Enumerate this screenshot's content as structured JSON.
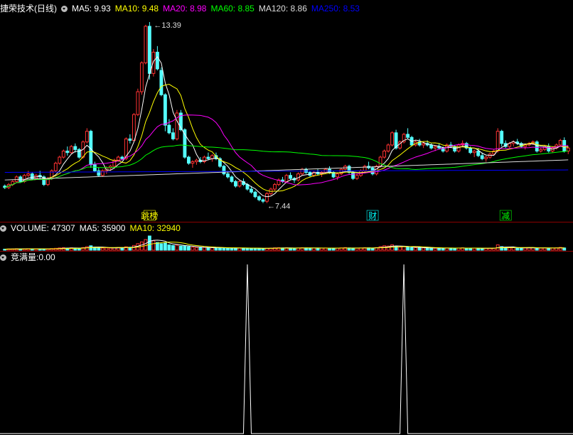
{
  "chart_data": [
    {
      "type": "candlestick",
      "title": "捷荣技术(日线)",
      "indicators": [
        {
          "label": "MA5",
          "value": "9.93",
          "color": "#ffffff"
        },
        {
          "label": "MA10",
          "value": "9.48",
          "color": "#ffff00"
        },
        {
          "label": "MA20",
          "value": "8.98",
          "color": "#ff00ff"
        },
        {
          "label": "MA60",
          "value": "8.85",
          "color": "#00ff00"
        },
        {
          "label": "MA120",
          "value": "8.86",
          "color": "#dddddd"
        },
        {
          "label": "MA250",
          "value": "8.53",
          "color": "#0000ff"
        }
      ],
      "ylim": [
        7.2,
        13.6
      ],
      "high_label": "13.39",
      "low_label": "7.44",
      "markers": [
        {
          "text": "跳榜",
          "index": 37,
          "color": "#ffff00"
        },
        {
          "text": "财",
          "index": 94,
          "color": "#00ffff"
        },
        {
          "text": "减",
          "index": 128,
          "color": "#00ff00"
        }
      ],
      "ohlc": [
        [
          8.0,
          8.05,
          7.9,
          7.95
        ],
        [
          7.95,
          8.1,
          7.9,
          8.05
        ],
        [
          8.05,
          8.2,
          8.0,
          8.15
        ],
        [
          8.15,
          8.35,
          8.1,
          8.3
        ],
        [
          8.3,
          8.35,
          8.1,
          8.15
        ],
        [
          8.15,
          8.4,
          8.1,
          8.35
        ],
        [
          8.35,
          8.5,
          8.3,
          8.4
        ],
        [
          8.4,
          8.45,
          8.2,
          8.25
        ],
        [
          8.25,
          8.4,
          8.2,
          8.35
        ],
        [
          8.35,
          8.5,
          8.2,
          8.3
        ],
        [
          8.3,
          8.35,
          8.0,
          8.05
        ],
        [
          8.05,
          8.3,
          8.0,
          8.25
        ],
        [
          8.25,
          8.55,
          8.2,
          8.5
        ],
        [
          8.5,
          8.8,
          8.45,
          8.75
        ],
        [
          8.75,
          9.0,
          8.7,
          8.95
        ],
        [
          8.95,
          9.2,
          8.9,
          9.15
        ],
        [
          9.15,
          9.3,
          9.0,
          9.1
        ],
        [
          9.1,
          9.35,
          9.05,
          9.3
        ],
        [
          9.3,
          9.4,
          9.1,
          9.2
        ],
        [
          9.2,
          9.25,
          8.9,
          8.95
        ],
        [
          8.95,
          9.5,
          8.9,
          9.45
        ],
        [
          9.45,
          9.9,
          9.4,
          9.8
        ],
        [
          9.8,
          9.85,
          8.6,
          8.7
        ],
        [
          8.7,
          8.8,
          8.45,
          8.5
        ],
        [
          8.5,
          8.6,
          8.3,
          8.35
        ],
        [
          8.35,
          8.55,
          8.3,
          8.5
        ],
        [
          8.5,
          8.65,
          8.4,
          8.6
        ],
        [
          8.6,
          8.7,
          8.5,
          8.65
        ],
        [
          8.65,
          8.9,
          8.6,
          8.85
        ],
        [
          8.85,
          9.0,
          8.8,
          8.95
        ],
        [
          8.95,
          9.0,
          8.85,
          8.9
        ],
        [
          8.9,
          9.6,
          8.85,
          9.55
        ],
        [
          9.55,
          9.7,
          9.4,
          9.5
        ],
        [
          9.5,
          10.4,
          9.45,
          10.35
        ],
        [
          10.35,
          11.2,
          10.3,
          11.1
        ],
        [
          11.1,
          12.1,
          11.0,
          12.05
        ],
        [
          12.05,
          13.3,
          12.0,
          13.25
        ],
        [
          13.25,
          13.39,
          11.5,
          11.7
        ],
        [
          11.7,
          12.5,
          11.6,
          12.4
        ],
        [
          12.4,
          12.6,
          11.8,
          11.85
        ],
        [
          11.8,
          11.9,
          10.95,
          11.0
        ],
        [
          11.0,
          11.05,
          9.8,
          10.0
        ],
        [
          10.0,
          10.2,
          9.7,
          9.75
        ],
        [
          9.75,
          9.9,
          9.5,
          9.55
        ],
        [
          9.55,
          10.5,
          9.5,
          10.4
        ],
        [
          10.4,
          10.5,
          9.8,
          9.85
        ],
        [
          9.85,
          9.9,
          8.9,
          8.95
        ],
        [
          8.95,
          9.0,
          8.7,
          8.75
        ],
        [
          8.75,
          8.85,
          8.6,
          8.8
        ],
        [
          8.8,
          8.9,
          8.7,
          8.85
        ],
        [
          8.85,
          8.95,
          8.75,
          8.8
        ],
        [
          8.8,
          9.0,
          8.75,
          8.95
        ],
        [
          8.95,
          9.1,
          8.85,
          8.9
        ],
        [
          8.9,
          9.05,
          8.8,
          9.0
        ],
        [
          9.0,
          9.1,
          8.85,
          8.9
        ],
        [
          8.9,
          8.95,
          8.6,
          8.65
        ],
        [
          8.65,
          8.7,
          8.35,
          8.4
        ],
        [
          8.4,
          8.5,
          8.25,
          8.3
        ],
        [
          8.3,
          8.35,
          8.1,
          8.15
        ],
        [
          8.15,
          8.2,
          7.95,
          8.0
        ],
        [
          8.0,
          8.2,
          7.95,
          8.15
        ],
        [
          8.15,
          8.25,
          8.0,
          8.05
        ],
        [
          8.05,
          8.1,
          7.85,
          7.9
        ],
        [
          7.9,
          8.0,
          7.75,
          7.8
        ],
        [
          7.8,
          7.85,
          7.6,
          7.65
        ],
        [
          7.65,
          7.7,
          7.5,
          7.55
        ],
        [
          7.55,
          7.6,
          7.44,
          7.5
        ],
        [
          7.5,
          7.8,
          7.44,
          7.75
        ],
        [
          7.75,
          7.95,
          7.7,
          7.9
        ],
        [
          7.9,
          8.1,
          7.85,
          8.05
        ],
        [
          8.05,
          8.25,
          8.0,
          8.2
        ],
        [
          8.2,
          8.3,
          8.1,
          8.15
        ],
        [
          8.15,
          8.4,
          8.1,
          8.35
        ],
        [
          8.35,
          8.45,
          8.2,
          8.25
        ],
        [
          8.25,
          8.3,
          8.1,
          8.2
        ],
        [
          8.2,
          8.45,
          8.15,
          8.4
        ],
        [
          8.4,
          8.6,
          8.35,
          8.55
        ],
        [
          8.55,
          8.6,
          8.4,
          8.45
        ],
        [
          8.45,
          8.5,
          8.3,
          8.35
        ],
        [
          8.35,
          8.5,
          8.3,
          8.45
        ],
        [
          8.45,
          8.55,
          8.35,
          8.4
        ],
        [
          8.4,
          8.5,
          8.3,
          8.45
        ],
        [
          8.45,
          8.6,
          8.4,
          8.55
        ],
        [
          8.55,
          8.65,
          8.4,
          8.45
        ],
        [
          8.45,
          8.5,
          8.25,
          8.3
        ],
        [
          8.3,
          8.45,
          8.2,
          8.4
        ],
        [
          8.4,
          8.6,
          8.35,
          8.55
        ],
        [
          8.55,
          8.7,
          8.5,
          8.65
        ],
        [
          8.65,
          8.7,
          8.4,
          8.45
        ],
        [
          8.45,
          8.5,
          8.2,
          8.25
        ],
        [
          8.25,
          8.4,
          8.2,
          8.35
        ],
        [
          8.35,
          8.55,
          8.3,
          8.5
        ],
        [
          8.5,
          8.7,
          8.45,
          8.65
        ],
        [
          8.65,
          8.8,
          8.55,
          8.6
        ],
        [
          8.6,
          8.65,
          8.35,
          8.4
        ],
        [
          8.4,
          8.7,
          8.35,
          8.65
        ],
        [
          8.65,
          9.0,
          8.6,
          8.95
        ],
        [
          8.95,
          9.2,
          8.9,
          9.15
        ],
        [
          9.15,
          9.4,
          9.1,
          9.35
        ],
        [
          9.35,
          9.8,
          9.3,
          9.75
        ],
        [
          9.75,
          9.85,
          9.2,
          9.25
        ],
        [
          9.25,
          9.5,
          9.2,
          9.45
        ],
        [
          9.45,
          9.75,
          9.4,
          9.7
        ],
        [
          9.7,
          9.9,
          9.55,
          9.6
        ],
        [
          9.6,
          9.65,
          9.3,
          9.35
        ],
        [
          9.35,
          9.5,
          9.3,
          9.45
        ],
        [
          9.45,
          9.55,
          9.3,
          9.35
        ],
        [
          9.35,
          9.45,
          9.25,
          9.4
        ],
        [
          9.4,
          9.5,
          9.3,
          9.35
        ],
        [
          9.35,
          9.4,
          9.2,
          9.25
        ],
        [
          9.25,
          9.35,
          9.15,
          9.3
        ],
        [
          9.3,
          9.4,
          9.2,
          9.25
        ],
        [
          9.25,
          9.3,
          9.1,
          9.15
        ],
        [
          9.15,
          9.4,
          9.1,
          9.35
        ],
        [
          9.35,
          9.45,
          9.25,
          9.3
        ],
        [
          9.3,
          9.35,
          9.1,
          9.15
        ],
        [
          9.15,
          9.4,
          9.1,
          9.35
        ],
        [
          9.35,
          9.5,
          9.3,
          9.4
        ],
        [
          9.4,
          9.45,
          9.2,
          9.25
        ],
        [
          9.25,
          9.3,
          9.05,
          9.1
        ],
        [
          9.1,
          9.2,
          8.95,
          9.15
        ],
        [
          9.15,
          9.25,
          8.95,
          9.0
        ],
        [
          9.0,
          9.1,
          8.85,
          8.9
        ],
        [
          8.9,
          9.0,
          8.8,
          8.95
        ],
        [
          8.95,
          9.1,
          8.9,
          9.05
        ],
        [
          9.05,
          9.2,
          9.0,
          9.15
        ],
        [
          9.15,
          9.9,
          9.1,
          9.8
        ],
        [
          9.8,
          9.85,
          9.3,
          9.4
        ],
        [
          9.4,
          9.5,
          9.25,
          9.3
        ],
        [
          9.3,
          9.45,
          9.25,
          9.4
        ],
        [
          9.4,
          9.5,
          9.3,
          9.45
        ],
        [
          9.45,
          9.55,
          9.35,
          9.4
        ],
        [
          9.4,
          9.45,
          9.25,
          9.3
        ],
        [
          9.3,
          9.4,
          9.2,
          9.35
        ],
        [
          9.35,
          9.45,
          9.3,
          9.4
        ],
        [
          9.4,
          9.5,
          9.35,
          9.45
        ],
        [
          9.45,
          9.5,
          9.1,
          9.15
        ],
        [
          9.15,
          9.25,
          9.1,
          9.2
        ],
        [
          9.2,
          9.35,
          9.15,
          9.3
        ],
        [
          9.3,
          9.4,
          9.1,
          9.15
        ],
        [
          9.15,
          9.3,
          9.1,
          9.25
        ],
        [
          9.25,
          9.4,
          9.2,
          9.35
        ],
        [
          9.35,
          9.55,
          9.3,
          9.5
        ],
        [
          9.5,
          9.6,
          9.1,
          9.15
        ],
        [
          9.15,
          9.3,
          9.05,
          9.25
        ]
      ]
    },
    {
      "type": "bar",
      "title": "VOLUME",
      "indicators": [
        {
          "label": "VOLUME",
          "value": "47307",
          "color": "#ffffff"
        },
        {
          "label": "MA5",
          "value": "35900",
          "color": "#ffffff"
        },
        {
          "label": "MA10",
          "value": "32940",
          "color": "#ffff00"
        }
      ],
      "values": [
        18000,
        20000,
        22000,
        25000,
        21000,
        24000,
        26000,
        23000,
        25000,
        22000,
        19000,
        22000,
        28000,
        32000,
        38000,
        42000,
        36000,
        40000,
        33000,
        30000,
        45000,
        60000,
        75000,
        52000,
        40000,
        36000,
        38000,
        35000,
        42000,
        45000,
        40000,
        58000,
        50000,
        80000,
        110000,
        140000,
        180000,
        240000,
        160000,
        130000,
        110000,
        120000,
        90000,
        80000,
        85000,
        70000,
        75000,
        60000,
        50000,
        45000,
        42000,
        46000,
        44000,
        43000,
        40000,
        42000,
        38000,
        36000,
        35000,
        34000,
        38000,
        36000,
        35000,
        32000,
        30000,
        29000,
        28000,
        33000,
        35000,
        40000,
        42000,
        38000,
        40000,
        36000,
        34000,
        38000,
        42000,
        38000,
        35000,
        36000,
        34000,
        35000,
        38000,
        34000,
        32000,
        35000,
        40000,
        44000,
        38000,
        33000,
        34000,
        38000,
        42000,
        40000,
        36000,
        44000,
        60000,
        75000,
        70000,
        90000,
        65000,
        55000,
        60000,
        52000,
        45000,
        42000,
        40000,
        38000,
        40000,
        36000,
        34000,
        36000,
        33000,
        38000,
        36000,
        34000,
        37000,
        40000,
        36000,
        33000,
        34000,
        32000,
        30000,
        31000,
        33000,
        35000,
        90000,
        60000,
        45000,
        40000,
        42000,
        38000,
        36000,
        38000,
        40000,
        42000,
        38000,
        36000,
        38000,
        35000,
        37000,
        40000,
        47307,
        38000
      ]
    },
    {
      "type": "line",
      "title": "竞满量",
      "indicators": [
        {
          "label": "竞满量",
          "value": "0.00",
          "color": "#ffffff"
        }
      ],
      "ylim": [
        0,
        1
      ],
      "values_by_index": [
        {
          "index": 0,
          "value": 0
        },
        {
          "index": 61,
          "value": 0
        },
        {
          "index": 62,
          "value": 1
        },
        {
          "index": 63,
          "value": 0
        },
        {
          "index": 101,
          "value": 0
        },
        {
          "index": 102,
          "value": 1
        },
        {
          "index": 103,
          "value": 0
        },
        {
          "index": 146,
          "value": 0
        }
      ]
    }
  ]
}
